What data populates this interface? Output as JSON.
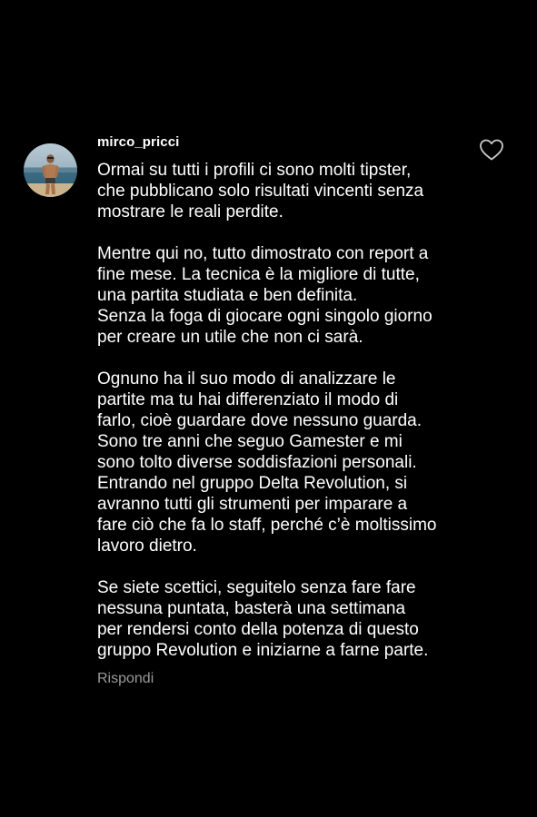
{
  "comment": {
    "username": "mirco_pricci",
    "avatar_icon": "profile-photo-avatar",
    "like_icon": "heart-outline-icon",
    "paragraphs": [
      {
        "lines": [
          "Ormai su tutti i profili ci sono molti tipster,",
          "che pubblicano solo risultati vincenti senza",
          "mostrare le reali perdite."
        ]
      },
      {
        "lines": [
          "Mentre qui no, tutto dimostrato con report a",
          "fine mese. La tecnica è la migliore di tutte,",
          "una partita studiata e ben definita.",
          "Senza la foga di giocare ogni singolo giorno",
          "per creare un utile che non ci sarà."
        ]
      },
      {
        "lines": [
          "Ognuno ha il suo modo di analizzare le",
          "partite ma tu hai differenziato il modo di",
          "farlo, cioè guardare dove nessuno guarda.",
          "Sono tre anni che seguo Gamester e mi",
          "sono tolto diverse soddisfazioni personali.",
          "Entrando nel gruppo Delta Revolution, si",
          "avranno tutti gli strumenti per imparare a",
          "fare ciò che fa lo staff, perché c’è moltissimo",
          "lavoro dietro."
        ]
      },
      {
        "lines": [
          "Se siete scettici, seguitelo senza fare fare",
          "nessuna puntata, basterà una settimana",
          "per rendersi conto della potenza di questo",
          "gruppo Revolution e iniziarne a farne parte."
        ]
      }
    ],
    "reply_label": "Rispondi"
  },
  "colors": {
    "background": "#000000",
    "text": "#ffffff",
    "secondary_text": "#9a9a9a"
  }
}
